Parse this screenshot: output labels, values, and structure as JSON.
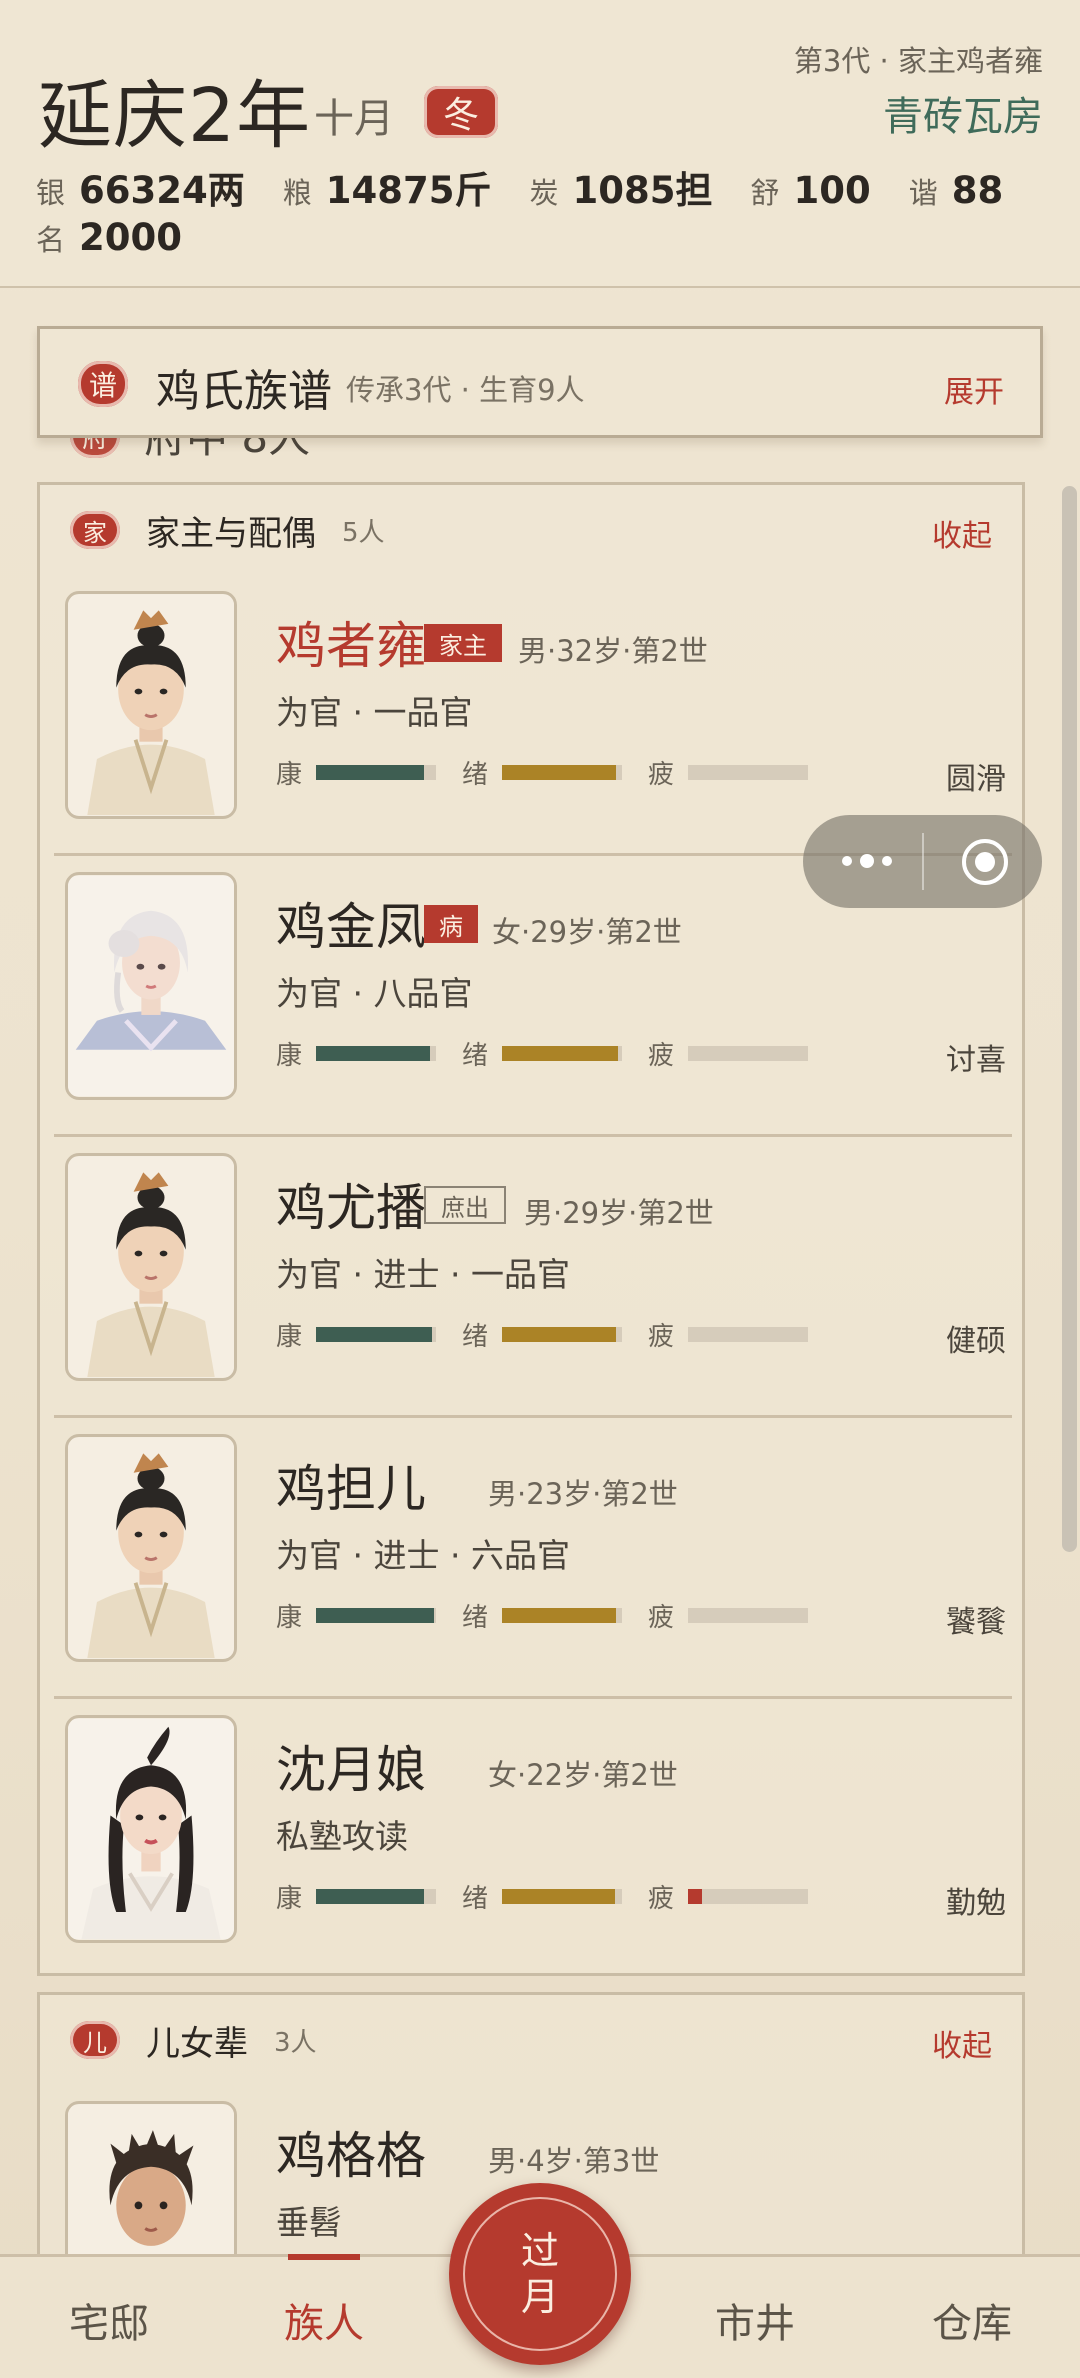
{
  "header": {
    "date": "延庆2年",
    "month": "十月",
    "season": "冬",
    "generation_line": "第3代 · 家主鸡者雍",
    "house_type": "青砖瓦房",
    "resources": [
      {
        "label": "银",
        "value": "66324两"
      },
      {
        "label": "粮",
        "value": "14875斤"
      },
      {
        "label": "炭",
        "value": "1085担"
      },
      {
        "label": "舒",
        "value": "100"
      },
      {
        "label": "谐",
        "value": "88"
      }
    ],
    "fame": {
      "label": "名",
      "value": "2000"
    }
  },
  "genealogy": {
    "seal": "谱",
    "title": "鸡氏族谱",
    "subtitle": "传承3代 · 生育9人",
    "toggle": "展开"
  },
  "peek": {
    "seal": "府",
    "text": "府中 8人"
  },
  "bar_labels": {
    "health": "康",
    "mood": "绪",
    "fatigue": "疲"
  },
  "section_head": {
    "seal": "家",
    "title": "家主与配偶",
    "count": "5人",
    "toggle": "收起",
    "members": [
      {
        "name": "鸡者雍",
        "tag": "家主",
        "info": "男·32岁·第2世",
        "job": "为官 · 一品官",
        "health": 0.9,
        "mood": 0.95,
        "fatigue": 0.0,
        "trait": "圆滑"
      },
      {
        "name": "鸡金凤",
        "tag": "病",
        "info": "女·29岁·第2世",
        "job": "为官 · 八品官",
        "health": 0.95,
        "mood": 0.97,
        "fatigue": 0.0,
        "trait": "讨喜"
      },
      {
        "name": "鸡尤播",
        "tag": "庶出",
        "info": "男·29岁·第2世",
        "job": "为官 · 进士 · 一品官",
        "health": 0.97,
        "mood": 0.95,
        "fatigue": 0.0,
        "trait": "健硕"
      },
      {
        "name": "鸡担儿",
        "tag": "",
        "info": "男·23岁·第2世",
        "job": "为官 · 进士 · 六品官",
        "health": 0.98,
        "mood": 0.95,
        "fatigue": 0.0,
        "trait": "饕餮"
      },
      {
        "name": "沈月娘",
        "tag": "",
        "info": "女·22岁·第2世",
        "job": "私塾攻读",
        "health": 0.9,
        "mood": 0.94,
        "fatigue": 0.12,
        "trait": "勤勉"
      }
    ]
  },
  "section_children": {
    "seal": "儿",
    "title": "儿女辈",
    "count": "3人",
    "toggle": "收起",
    "members": [
      {
        "name": "鸡格格",
        "info": "男·4岁·第3世",
        "job": "垂髫"
      }
    ]
  },
  "nav": {
    "items": [
      "宅邸",
      "族人",
      "市井",
      "仓库"
    ],
    "active": "族人",
    "fab_line1": "过",
    "fab_line2": "月"
  },
  "colors": {
    "accent": "#b53a2e",
    "health": "#3e5e52",
    "mood": "#ab8326",
    "house": "#3f6b5a"
  }
}
